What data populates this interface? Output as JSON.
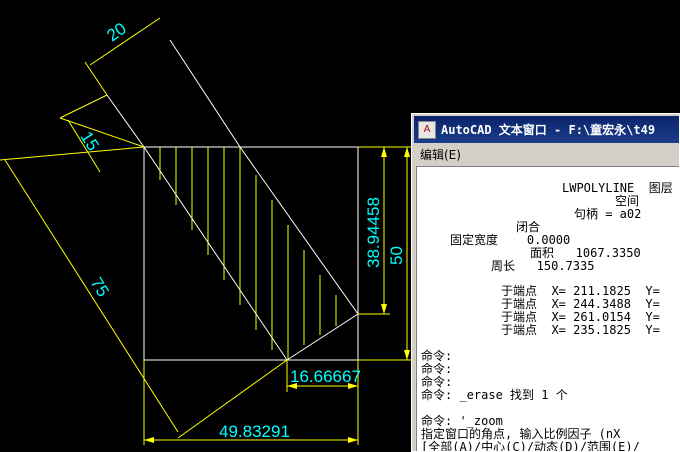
{
  "drawing": {
    "dimensions": {
      "width_top": "20",
      "offset_left": "15",
      "length_diag": "75",
      "height_hatch": "38.94458",
      "height_square": "50",
      "short_horizontal": "16.66667",
      "bottom_width": "49.83291"
    },
    "colors": {
      "background": "#000000",
      "geometry": "#ffffff",
      "dimension_lines": "#ffff00",
      "dimension_text": "#00ffff",
      "hatch": "#ffff00"
    }
  },
  "text_window": {
    "title": "AutoCAD 文本窗口 - F:\\童宏永\\t49",
    "app_icon": "autocad-icon",
    "menu": {
      "edit": "编辑(E)"
    },
    "lines": [
      "LWPOLYLINE  图层",
      "空间",
      "句柄 = a02",
      "闭合",
      "固定宽度    0.0000",
      "面积   1067.3350",
      "周长   150.7335",
      "于端点  X= 211.1825  Y=",
      "于端点  X= 244.3488  Y=",
      "于端点  X= 261.0154  Y=",
      "于端点  X= 235.1825  Y=",
      "命令:",
      "命令:",
      "命令:",
      "命令: _erase 找到 1 个",
      "命令: '_zoom",
      "指定窗口的角点, 输入比例因子 (nX",
      "[全部(A)/中心(C)/动态(D)/范围(E)/"
    ]
  }
}
